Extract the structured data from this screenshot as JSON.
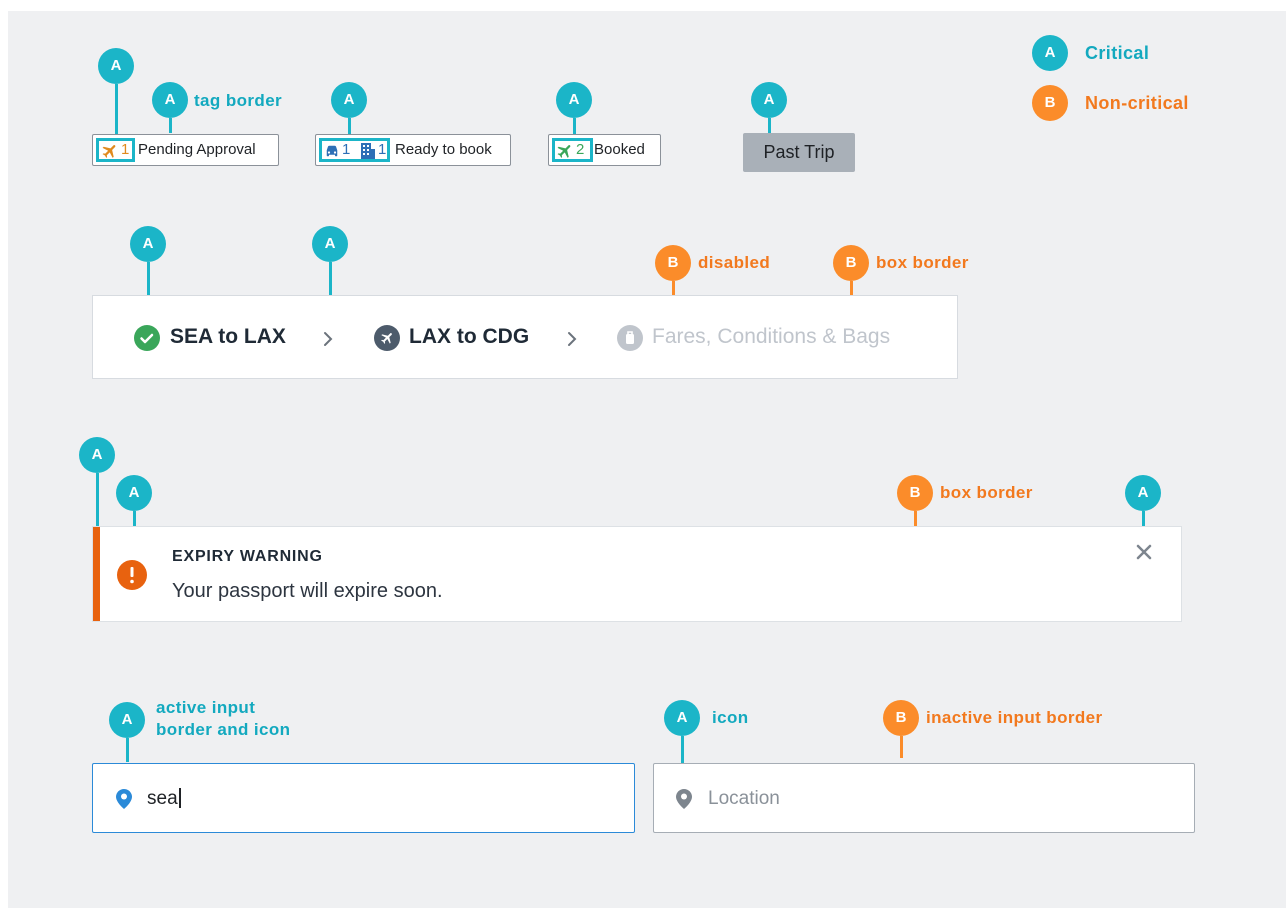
{
  "legend": {
    "critical": {
      "marker": "A",
      "label": "Critical",
      "color": "#1bb5c8"
    },
    "non_critical": {
      "marker": "B",
      "label": "Non-critical",
      "color": "#fb8c2a"
    }
  },
  "tags_row": {
    "pending": {
      "count": "1",
      "label": "Pending Approval",
      "icon": "plane-icon"
    },
    "ready": {
      "car_count": "1",
      "hotel_count": "1",
      "label": "Ready to book"
    },
    "booked": {
      "count": "2",
      "label": "Booked",
      "icon": "plane-icon"
    },
    "past_trip": {
      "label": "Past Trip"
    },
    "note_tag_border": "tag border"
  },
  "stepper": {
    "step1": "SEA to LAX",
    "step2": "LAX to CDG",
    "step3": "Fares, Conditions & Bags",
    "note_disabled": "disabled",
    "note_box_border": "box border"
  },
  "alert": {
    "title": "EXPIRY WARNING",
    "message": "Your passport will expire soon.",
    "note_box_border": "box border"
  },
  "inputs": {
    "active_value": "sea",
    "inactive_placeholder": "Location",
    "note_active_line1": "active input",
    "note_active_line2": "border and icon",
    "note_icon": "icon",
    "note_inactive": "inactive input border"
  },
  "markers": {
    "a": "A",
    "b": "B"
  },
  "colors": {
    "background": "#eff0f2",
    "teal": "#1bb5c8",
    "orange": "#fb8c2a",
    "alert_orange": "#e8620f",
    "active_blue": "#2b8ad8",
    "success_green": "#3aa65a"
  }
}
